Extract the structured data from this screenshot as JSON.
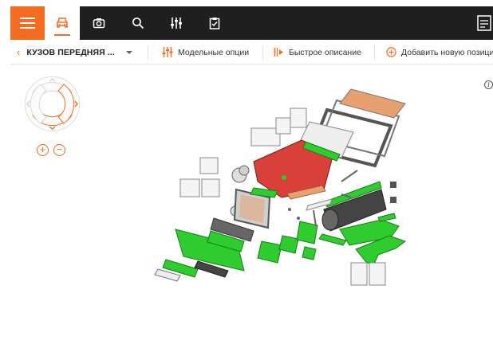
{
  "topbar": {
    "tabs": [
      {
        "name": "car-icon",
        "active": true
      },
      {
        "name": "camera-icon",
        "active": false
      },
      {
        "name": "search-icon",
        "active": false
      },
      {
        "name": "sliders-icon",
        "active": false
      },
      {
        "name": "clipboard-check-icon",
        "active": false
      }
    ],
    "right_icon": "document-icon"
  },
  "toolbar": {
    "breadcrumb_title": "КУЗОВ ПЕРЕДНЯЯ ...",
    "model_options_label": "Модельные опции",
    "quick_description_label": "Быстрое описание",
    "add_position_label": "Добавить новую позицию"
  },
  "viewer": {
    "zoom_in": "+",
    "zoom_out": "−",
    "info": "i"
  },
  "colors": {
    "accent": "#f36c21",
    "topbar": "#1f1f1f",
    "part_green": "#2ecc2e",
    "part_red": "#d9403a",
    "part_orange": "#e8a070",
    "part_dark": "#444444"
  }
}
